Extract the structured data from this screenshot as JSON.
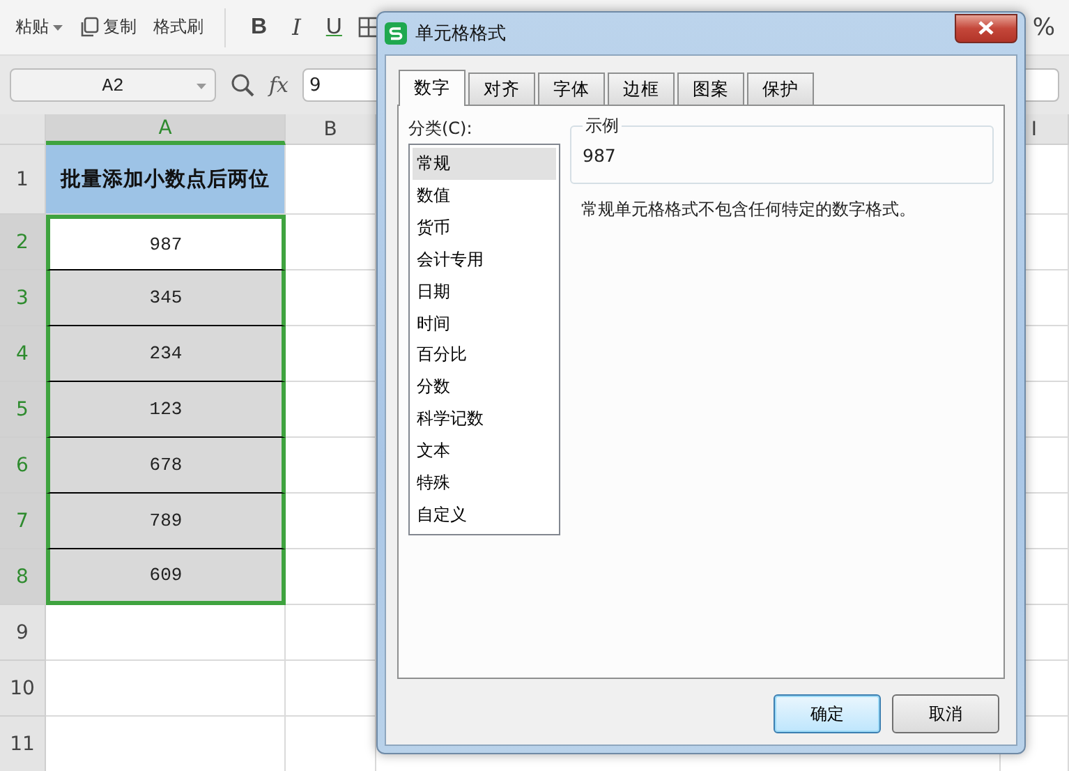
{
  "toolbar": {
    "paste": {
      "label": "粘贴"
    },
    "copy": {
      "label": "复制"
    },
    "format_painter": {
      "label": "格式刷"
    },
    "font_buttons": [
      {
        "label": "B",
        "kind": "bold"
      },
      {
        "label": "I",
        "kind": "italic"
      },
      {
        "label": "U",
        "kind": "underline"
      }
    ],
    "percent": "%"
  },
  "formula_bar": {
    "name_box": "A2",
    "fx": "fx",
    "value": "9"
  },
  "columns": [
    {
      "label": "A",
      "selected": true
    },
    {
      "label": "B",
      "selected": false
    },
    {
      "label": "I",
      "selected": false
    }
  ],
  "rows": [
    {
      "number": "1",
      "selected": false,
      "kind": "header",
      "cell": "批量添加小数点后两位"
    },
    {
      "number": "2",
      "selected": true,
      "kind": "active",
      "cell": "987"
    },
    {
      "number": "3",
      "selected": true,
      "kind": "data",
      "cell": "345"
    },
    {
      "number": "4",
      "selected": true,
      "kind": "data",
      "cell": "234"
    },
    {
      "number": "5",
      "selected": true,
      "kind": "data",
      "cell": "123"
    },
    {
      "number": "6",
      "selected": true,
      "kind": "data",
      "cell": "678"
    },
    {
      "number": "7",
      "selected": true,
      "kind": "data",
      "cell": "789"
    },
    {
      "number": "8",
      "selected": true,
      "kind": "data",
      "cell": "609"
    },
    {
      "number": "9",
      "selected": false,
      "kind": "empty"
    },
    {
      "number": "10",
      "selected": false,
      "kind": "empty"
    },
    {
      "number": "11",
      "selected": false,
      "kind": "empty"
    }
  ],
  "dialog": {
    "title": "单元格格式",
    "tabs": [
      {
        "label": "数字",
        "selected": true
      },
      {
        "label": "对齐",
        "selected": false
      },
      {
        "label": "字体",
        "selected": false
      },
      {
        "label": "边框",
        "selected": false
      },
      {
        "label": "图案",
        "selected": false
      },
      {
        "label": "保护",
        "selected": false
      }
    ],
    "category_label": "分类(C):",
    "categories": [
      {
        "label": "常规",
        "selected": true
      },
      {
        "label": "数值",
        "selected": false
      },
      {
        "label": "货币",
        "selected": false
      },
      {
        "label": "会计专用",
        "selected": false
      },
      {
        "label": "日期",
        "selected": false
      },
      {
        "label": "时间",
        "selected": false
      },
      {
        "label": "百分比",
        "selected": false
      },
      {
        "label": "分数",
        "selected": false
      },
      {
        "label": "科学记数",
        "selected": false
      },
      {
        "label": "文本",
        "selected": false
      },
      {
        "label": "特殊",
        "selected": false
      },
      {
        "label": "自定义",
        "selected": false
      }
    ],
    "sample": {
      "label": "示例",
      "value": "987"
    },
    "description": "常规单元格格式不包含任何特定的数字格式。",
    "buttons": [
      {
        "label": "确定",
        "default": true
      },
      {
        "label": "取消",
        "default": false
      }
    ]
  }
}
